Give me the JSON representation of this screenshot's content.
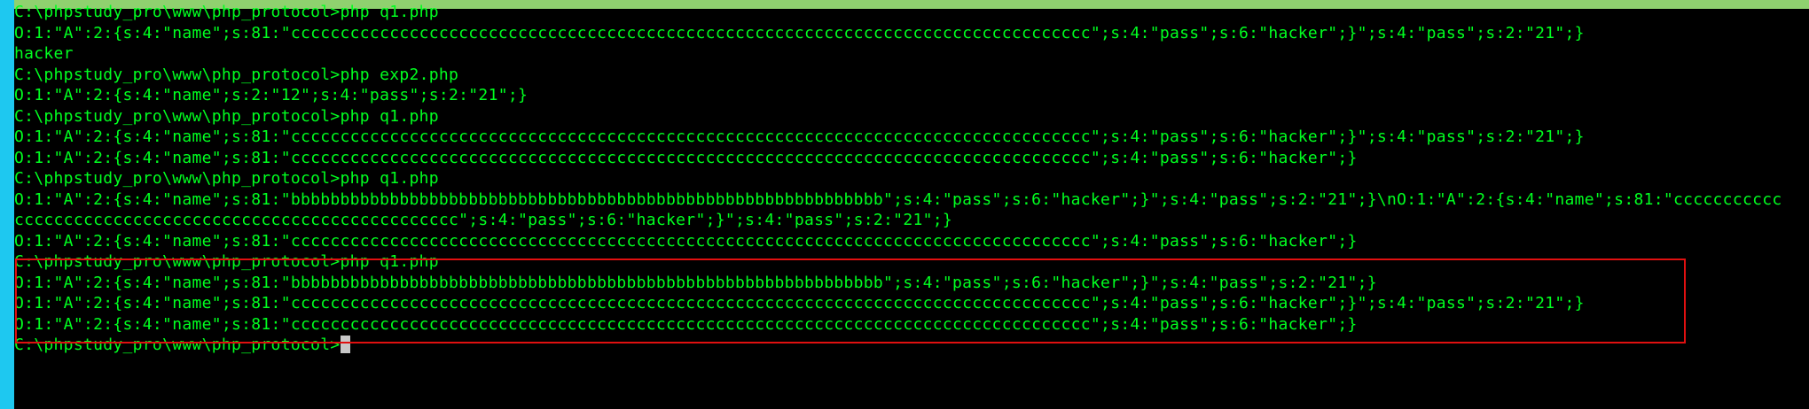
{
  "terminal": {
    "lines": [
      "C:\\phpstudy_pro\\www\\php_protocol>php q1.php",
      "O:1:\"A\":2:{s:4:\"name\";s:81:\"ccccccccccccccccccccccccccccccccccccccccccccccccccccccccccccccccccccccccccccccccc\";s:4:\"pass\";s:6:\"hacker\";}\";s:4:\"pass\";s:2:\"21\";}",
      "hacker",
      "C:\\phpstudy_pro\\www\\php_protocol>php exp2.php",
      "O:1:\"A\":2:{s:4:\"name\";s:2:\"12\";s:4:\"pass\";s:2:\"21\";}",
      "C:\\phpstudy_pro\\www\\php_protocol>php q1.php",
      "O:1:\"A\":2:{s:4:\"name\";s:81:\"ccccccccccccccccccccccccccccccccccccccccccccccccccccccccccccccccccccccccccccccccc\";s:4:\"pass\";s:6:\"hacker\";}\";s:4:\"pass\";s:2:\"21\";}",
      "O:1:\"A\":2:{s:4:\"name\";s:81:\"ccccccccccccccccccccccccccccccccccccccccccccccccccccccccccccccccccccccccccccccccc\";s:4:\"pass\";s:6:\"hacker\";}",
      "C:\\phpstudy_pro\\www\\php_protocol>php q1.php",
      "O:1:\"A\":2:{s:4:\"name\";s:81:\"bbbbbbbbbbbbbbbbbbbbbbbbbbbbbbbbbbbbbbbbbbbbbbbbbbbbbbbbbbbb\";s:4:\"pass\";s:6:\"hacker\";}\";s:4:\"pass\";s:2:\"21\";}\\nO:1:\"A\":2:{s:4:\"name\";s:81:\"ccccccccccc",
      "ccccccccccccccccccccccccccccccccccccccccccccc\";s:4:\"pass\";s:6:\"hacker\";}\";s:4:\"pass\";s:2:\"21\";}",
      "O:1:\"A\":2:{s:4:\"name\";s:81:\"ccccccccccccccccccccccccccccccccccccccccccccccccccccccccccccccccccccccccccccccccc\";s:4:\"pass\";s:6:\"hacker\";}",
      "C:\\phpstudy_pro\\www\\php_protocol>php q1.php",
      "O:1:\"A\":2:{s:4:\"name\";s:81:\"bbbbbbbbbbbbbbbbbbbbbbbbbbbbbbbbbbbbbbbbbbbbbbbbbbbbbbbbbbbb\";s:4:\"pass\";s:6:\"hacker\";}\";s:4:\"pass\";s:2:\"21\";}",
      "O:1:\"A\":2:{s:4:\"name\";s:81:\"ccccccccccccccccccccccccccccccccccccccccccccccccccccccccccccccccccccccccccccccccc\";s:4:\"pass\";s:6:\"hacker\";}\";s:4:\"pass\";s:2:\"21\";}",
      "O:1:\"A\":2:{s:4:\"name\";s:81:\"ccccccccccccccccccccccccccccccccccccccccccccccccccccccccccccccccccccccccccccccccc\";s:4:\"pass\";s:6:\"hacker\";}",
      "C:\\phpstudy_pro\\www\\php_protocol>"
    ]
  },
  "colors": {
    "background": "#000000",
    "text": "#00ff20",
    "highlight_border": "#e01010",
    "left_gutter": "#1ec8f0",
    "top_strip": "#8fd16f",
    "cursor": "#c8c8c8"
  }
}
